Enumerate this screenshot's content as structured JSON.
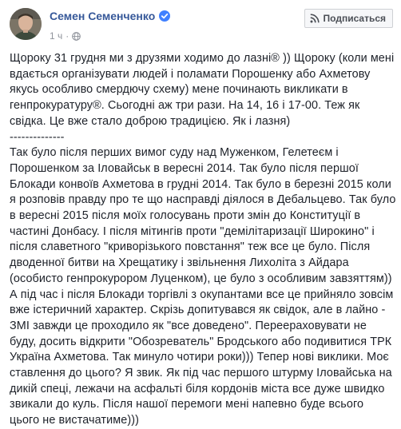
{
  "post": {
    "author": "Семен Семенченко",
    "timestamp": "1 ч",
    "subscribe_label": "Подписаться",
    "paragraph_1": "Щороку 31 грудня ми з друзями ходимо до лазні® )) Щороку (коли мені вдається організувати людей і поламати Порошенку або Ахметову якусь особливо смердючу схему) мене починають викликати в генпрокуратуру®. Сьогодні аж три рази. На 14, 16 і 17-00. Теж як свідка. Це вже стало доброю традицією. Як і лазня)",
    "separator": "--------------",
    "paragraph_2": "Так було після перших вимог суду над Муженком, Гелетеєм і Порошенком за Іловайськ в вересні 2014. Так було після першої Блокади конвоїв Ахметова в грудні 2014. Так було в березні 2015 коли я розповів правду про те що насправді діялося в Дебальцево. Так було в вересні 2015 після моїх голосувань проти змін до Конституції в частині Донбасу. І після мітингів проти \"демілітаризації Широкино\" і після славетного \"криворізького повстання\" теж все це було. Після дводенної битви на Хрещатику і звільнення Лихоліта з Айдара (особисто генпрокурором Луценком), це було з особливим завзяттям)) А під час і після Блокади торгівлі з окупантами все це прийняло зовсім вже істеричний характер. Скрізь допитувався як свідок, але в лайно - ЗМІ завжди це проходило як \"все доведено\". Переераховувати не буду, досить відкрити \"Обозреватель\" Бродського або подивитися ТРК Україна Ахметова. Так минуло чотири роки))) Тепер нові виклики. Моє ставлення до цього? Я звик. Як під час першого штурму Іловайська на дикій спеці, лежачи на асфальті біля кордонів міста все дуже швидко звикали до куль. Після нашої перемоги мені напевно буде всього цього не вистачатиме)))"
  },
  "colors": {
    "link": "#365899",
    "text": "#1d2129",
    "meta": "#90949c",
    "verified": "#4080ff"
  },
  "icons": {
    "verified": "verified-badge-icon",
    "privacy": "globe-icon",
    "subscribe": "rss-icon"
  }
}
